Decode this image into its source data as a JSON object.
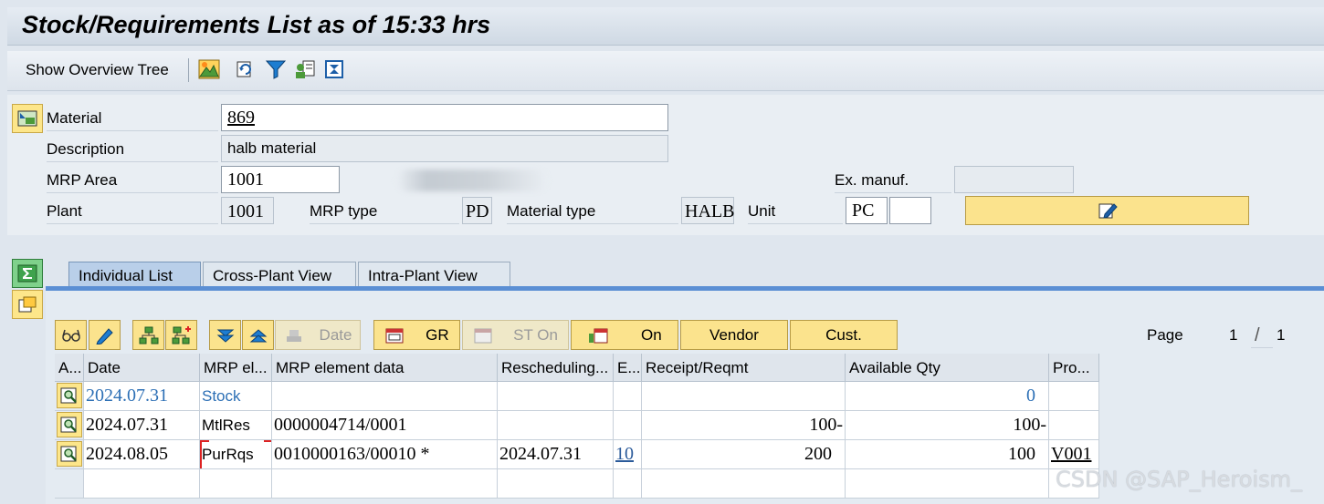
{
  "title": "Stock/Requirements List as of 15:33 hrs",
  "toolbar": {
    "show_overview_tree": "Show Overview Tree",
    "icons": [
      "landscape-icon",
      "refresh-icon",
      "filter-icon",
      "user-settings-icon",
      "print-icon"
    ]
  },
  "header": {
    "material_label": "Material",
    "material_value": "869",
    "description_label": "Description",
    "description_value": "halb material",
    "mrp_area_label": "MRP Area",
    "mrp_area_value": "1001",
    "ex_manuf_label": "Ex. manuf.",
    "ex_manuf_value": "",
    "plant_label": "Plant",
    "plant_value": "1001",
    "mrp_type_label": "MRP type",
    "mrp_type_value": "PD",
    "material_type_label": "Material type",
    "material_type_value": "HALB",
    "unit_label": "Unit",
    "unit_value": "PC",
    "unit_extra_value": ""
  },
  "tabs": [
    {
      "label": "Individual List",
      "active": true
    },
    {
      "label": "Cross-Plant View",
      "active": false
    },
    {
      "label": "Intra-Plant View",
      "active": false
    }
  ],
  "actions": {
    "date": "Date",
    "gr": "GR",
    "st_on": "ST On",
    "on": "On",
    "vendor": "Vendor",
    "cust": "Cust."
  },
  "paging": {
    "label": "Page",
    "current": "1",
    "separator": "/",
    "total": "1"
  },
  "grid": {
    "columns": [
      "A...",
      "Date",
      "MRP el...",
      "MRP element data",
      "Rescheduling...",
      "E...",
      "Receipt/Reqmt",
      "Available Qty",
      "Pro..."
    ],
    "rows": [
      {
        "date": "2024.07.31",
        "mrp_el": "Stock",
        "element_data": "",
        "resched": "",
        "e": "",
        "receipt": "",
        "available": "0",
        "pro": ""
      },
      {
        "date": "2024.07.31",
        "mrp_el": "MtlRes",
        "element_data": "0000004714/0001",
        "resched": "",
        "e": "",
        "receipt": "100-",
        "available": "100-",
        "pro": ""
      },
      {
        "date": "2024.08.05",
        "mrp_el": "PurRqs",
        "element_data": "0010000163/00010 *",
        "resched": "2024.07.31",
        "e": "10",
        "receipt": "200",
        "available": "100",
        "pro": "V001"
      }
    ]
  },
  "watermark": "CSDN @SAP_Heroism_"
}
